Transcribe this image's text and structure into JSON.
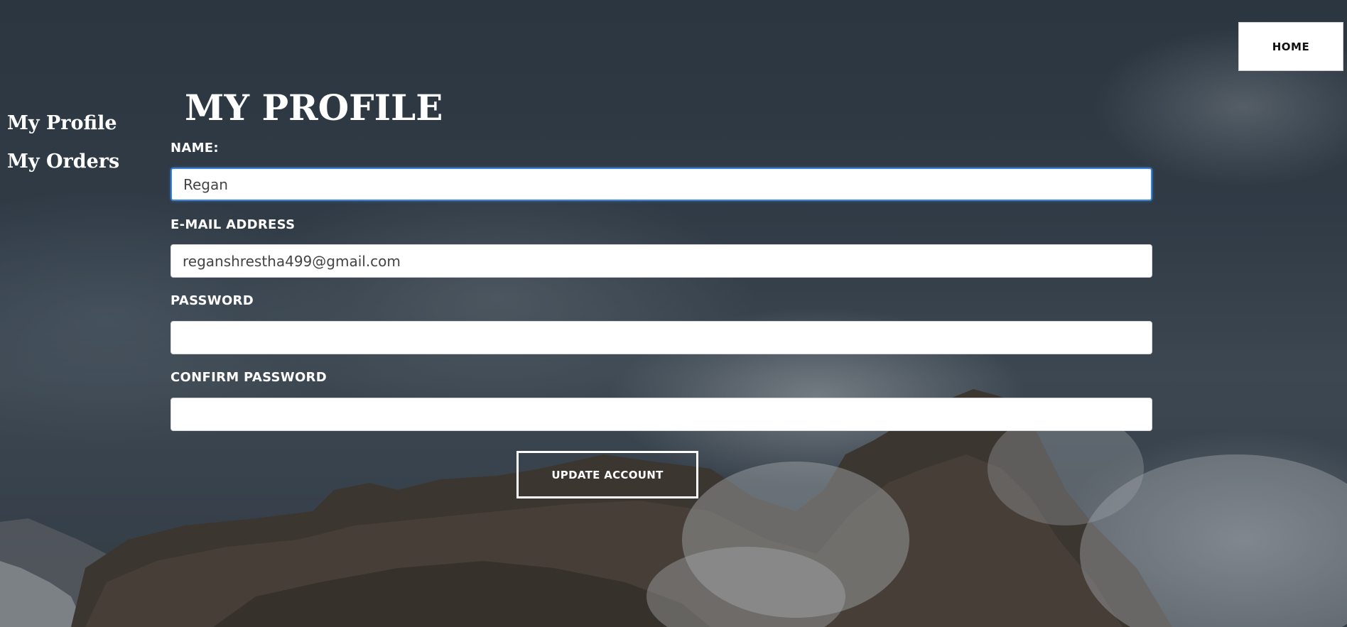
{
  "header": {
    "home_label": "HOME"
  },
  "sidebar": {
    "items": [
      {
        "label": "My Profile"
      },
      {
        "label": "My Orders"
      }
    ]
  },
  "main": {
    "title": "MY PROFILE",
    "fields": {
      "name": {
        "label": "NAME:",
        "value": "Regan",
        "placeholder": ""
      },
      "email": {
        "label": "E-MAIL ADDRESS",
        "value": "reganshrestha499@gmail.com",
        "placeholder": ""
      },
      "password": {
        "label": "PASSWORD",
        "value": "",
        "placeholder": ""
      },
      "confirm_password": {
        "label": "CONFIRM PASSWORD",
        "value": "",
        "placeholder": ""
      }
    },
    "submit_label": "UPDATE ACCOUNT"
  },
  "colors": {
    "focus_border": "#3b83d6",
    "text": "#ffffff",
    "input_bg": "#ffffff"
  }
}
